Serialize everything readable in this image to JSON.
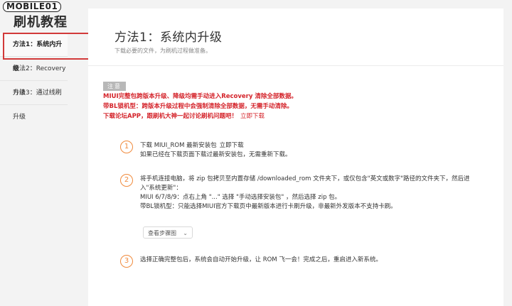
{
  "watermark": "MOBILE01",
  "sidebar": {
    "title": "刷机教程",
    "items": [
      {
        "label": "方法1：系统内升级",
        "active": true
      },
      {
        "label": "方法2：Recovery 升级",
        "active": false
      },
      {
        "label": "方法3：通过线刷升级",
        "active": false
      }
    ]
  },
  "header": {
    "title": "方法1：系统内升级",
    "subtitle": "下载必要的文件，为刷机过程做准备。"
  },
  "notice": {
    "tag": "注意",
    "line1": "MIUI完整包跨版本升级、降级均需手动进入Recovery 清除全部数据。",
    "line2": "带BL锁机型：跨版本升级过程中会强制清除全部数据，无需手动清除。",
    "line3": "下载论坛APP，跟刷机大神一起讨论刷机问题吧！",
    "line3_link": "立即下载"
  },
  "steps": [
    {
      "num": "1",
      "line1": "下载 MIUI_ROM 最新安装包",
      "line1_link": "立即下载",
      "line2": "如果已经在下载页面下载过最新安装包，无需重新下载。"
    },
    {
      "num": "2",
      "line1": "将手机连接电脑，将 zip 包拷贝至内置存储 /downloaded_rom 文件夹下，或仅包含\"英文或数字\"路径的文件夹下，然后进入\"系统更新\"：",
      "line2": "MIUI 6/7/8/9：点右上角 \"...\" 选择 \"手动选择安装包\" ，然后选择 zip 包。",
      "line3": "带BL锁机型：只能选择MIUI官方下载页中最新版本进行卡刷升级，非最新外发版本不支持卡刷。"
    },
    {
      "num": "3",
      "line1": "选择正确完整包后，系统会自动开始升级，让 ROM 飞一会！完成之后，重启进入新系统。"
    }
  ],
  "dropdown": {
    "label": "查看步骤图",
    "icon": "chevron-down-icon"
  },
  "colors": {
    "accent": "#f08a3c",
    "warning": "#d4232a",
    "highlight": "#d23a3a"
  }
}
